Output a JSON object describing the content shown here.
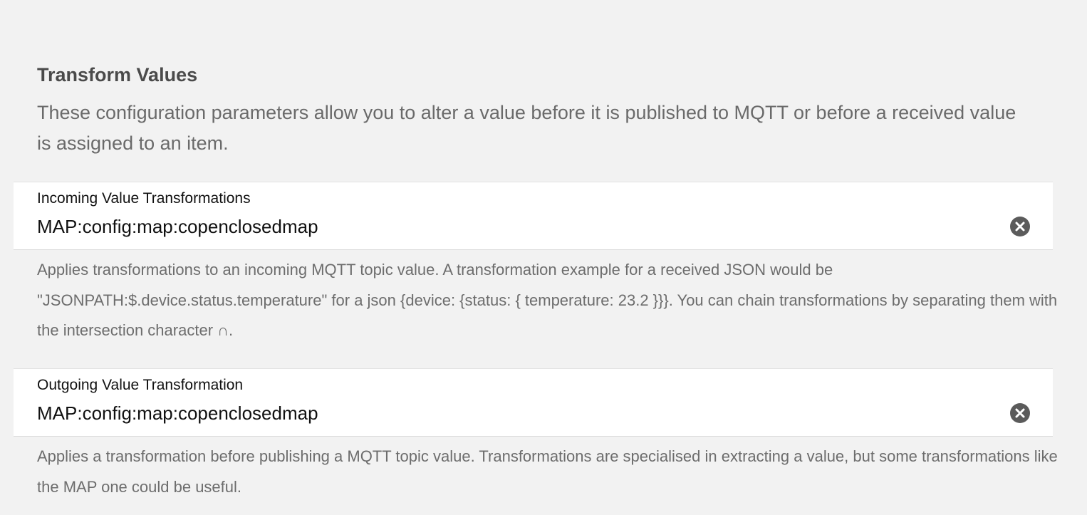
{
  "section": {
    "title": "Transform Values",
    "description": "These configuration parameters allow you to alter a value before it is published to MQTT or before a received value is assigned to an item."
  },
  "incoming": {
    "label": "Incoming Value Transformations",
    "value": "MAP:config:map:copenclosedmap",
    "clear_icon": "clear-circle-icon",
    "help": "Applies transformations to an incoming MQTT topic value. A transformation example for a received JSON would be \"JSONPATH:$.device.status.temperature\" for a json {device: {status: { temperature: 23.2 }}}. You can chain transformations by separating them with the intersection character ∩."
  },
  "outgoing": {
    "label": "Outgoing Value Transformation",
    "value": "MAP:config:map:copenclosedmap",
    "clear_icon": "clear-circle-icon",
    "help": "Applies a transformation before publishing a MQTT topic value. Transformations are specialised in extracting a value, but some transformations like the MAP one could be useful."
  },
  "colors": {
    "background": "#f2f2f2",
    "field_background": "#ffffff",
    "clear_icon": "#5b5b5b"
  }
}
